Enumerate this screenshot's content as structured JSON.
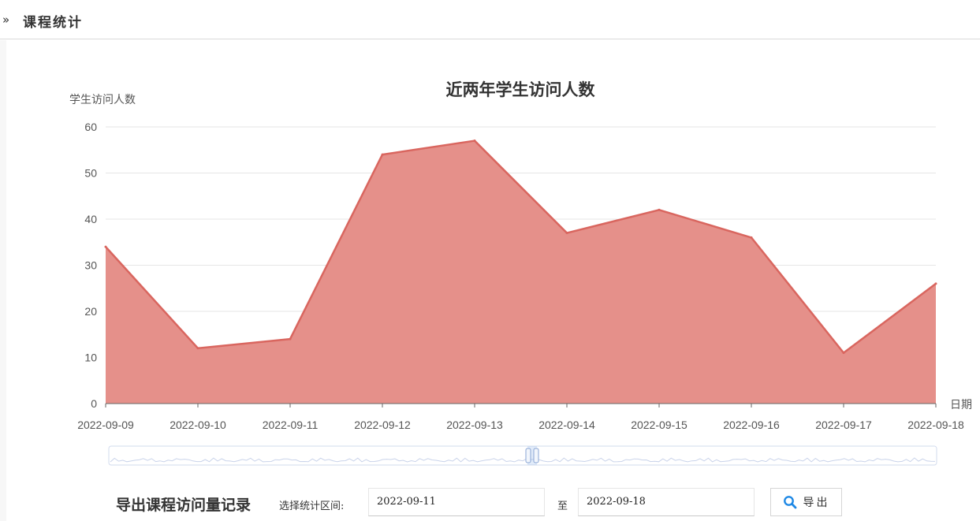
{
  "header": {
    "title": "课程统计",
    "chevron": "»"
  },
  "export": {
    "title": "导出课程访问量记录",
    "range_label": "选择统计区间:",
    "start_date": "2022-09-11",
    "to_label": "至",
    "end_date": "2022-09-18",
    "button_label": "导出",
    "button_icon": "search-icon"
  },
  "chart_data": {
    "type": "area",
    "title": "近两年学生访问人数",
    "ylabel": "学生访问人数",
    "xlabel": "日期",
    "categories": [
      "2022-09-09",
      "2022-09-10",
      "2022-09-11",
      "2022-09-12",
      "2022-09-13",
      "2022-09-14",
      "2022-09-15",
      "2022-09-16",
      "2022-09-17",
      "2022-09-18"
    ],
    "values": [
      34,
      12,
      14,
      54,
      57,
      37,
      42,
      36,
      11,
      26
    ],
    "ylim": [
      0,
      60
    ],
    "yticks": [
      0,
      10,
      20,
      30,
      40,
      50,
      60
    ],
    "grid": true,
    "color": "#d9665f",
    "fill": "#e5908a",
    "zoom_slider": true
  }
}
